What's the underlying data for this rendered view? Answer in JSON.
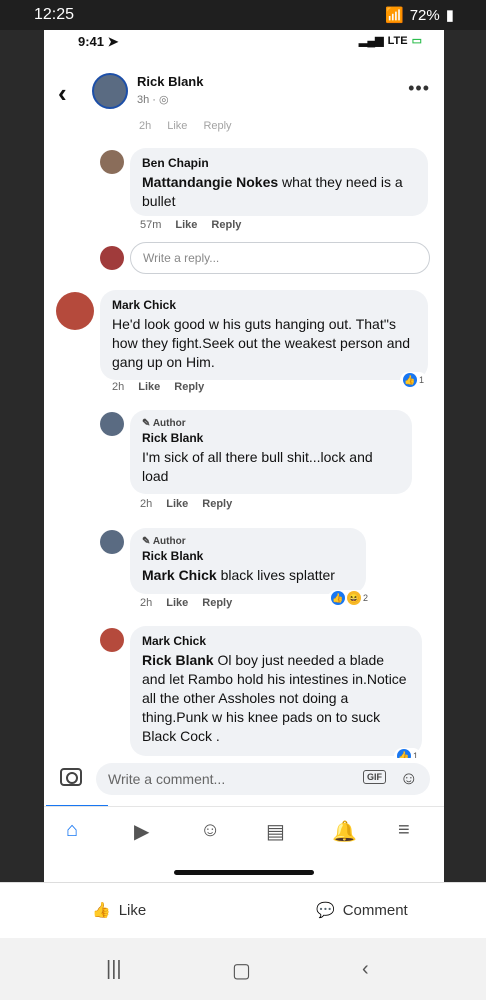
{
  "outer_status": {
    "time": "12:25",
    "battery": "72%"
  },
  "ios_status": {
    "time": "9:41",
    "network": "LTE"
  },
  "header": {
    "name": "Rick Blank",
    "meta": "3h ·"
  },
  "faded_meta": {
    "time": "2h",
    "like": "Like",
    "reply": "Reply"
  },
  "comments": [
    {
      "name": "Ben Chapin",
      "mention": "Mattandangie Nokes",
      "text": " what they need is a bullet",
      "time": "57m",
      "like": "Like",
      "reply": "Reply"
    },
    {
      "name": "Mark Chick",
      "text": "He'd look good w his guts hanging out. That''s how they fight.Seek out the weakest person and gang up on Him.",
      "time": "2h",
      "like": "Like",
      "reply": "Reply",
      "reaction_count": "1"
    },
    {
      "author_badge": "Author",
      "name": "Rick Blank",
      "text": "I'm sick of all there bull shit...lock and load",
      "time": "2h",
      "like": "Like",
      "reply": "Reply"
    },
    {
      "author_badge": "Author",
      "name": "Rick Blank",
      "mention": "Mark Chick",
      "text": " black lives splatter",
      "time": "2h",
      "like": "Like",
      "reply": "Reply",
      "reaction_count": "2"
    },
    {
      "name": "Mark Chick",
      "mention": "Rick Blank",
      "text": " Ol boy just needed a blade and let Rambo hold his intestines in.Notice all the other Assholes not doing a thing.Punk w his knee pads on to suck Black Cock .",
      "reaction_count": "1"
    }
  ],
  "reply_placeholder": "Write a reply...",
  "composer": {
    "placeholder": "Write a comment...",
    "gif": "GIF"
  },
  "actions": {
    "like": "Like",
    "comment": "Comment"
  }
}
